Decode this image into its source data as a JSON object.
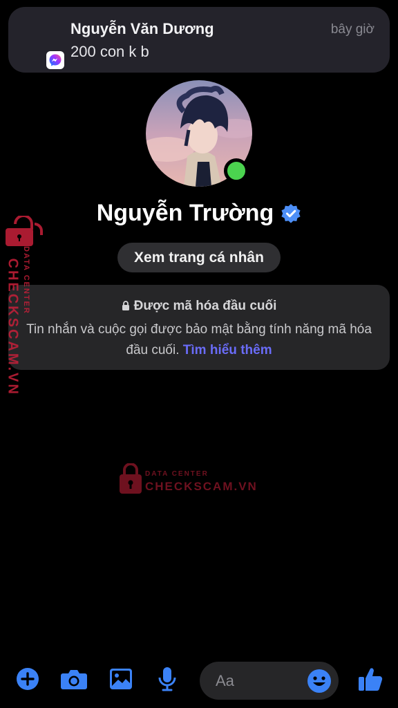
{
  "notification": {
    "sender": "Nguyễn Văn Dương",
    "message": "200 con k b",
    "time": "bây giờ",
    "app_icon": "messenger-icon"
  },
  "profile": {
    "name": "Nguyễn Trường",
    "verified": true,
    "online": true,
    "view_profile_label": "Xem trang cá nhân"
  },
  "encryption": {
    "title": "Được mã hóa đầu cuối",
    "body": "Tin nhắn và cuộc gọi được bảo mật bằng tính năng mã hóa đầu cuối.",
    "link": "Tìm hiểu thêm"
  },
  "watermark": {
    "brand": "CHECKSCAM.VN",
    "sub": "DATA CENTER"
  },
  "composer": {
    "placeholder": "Aa",
    "icons": [
      "plus-icon",
      "camera-icon",
      "image-icon",
      "microphone-icon",
      "emoji-icon",
      "like-icon"
    ]
  },
  "colors": {
    "accent": "#3b82f6",
    "link": "#6a6cf8",
    "online": "#4bd34f",
    "watermark": "#d0203a"
  }
}
